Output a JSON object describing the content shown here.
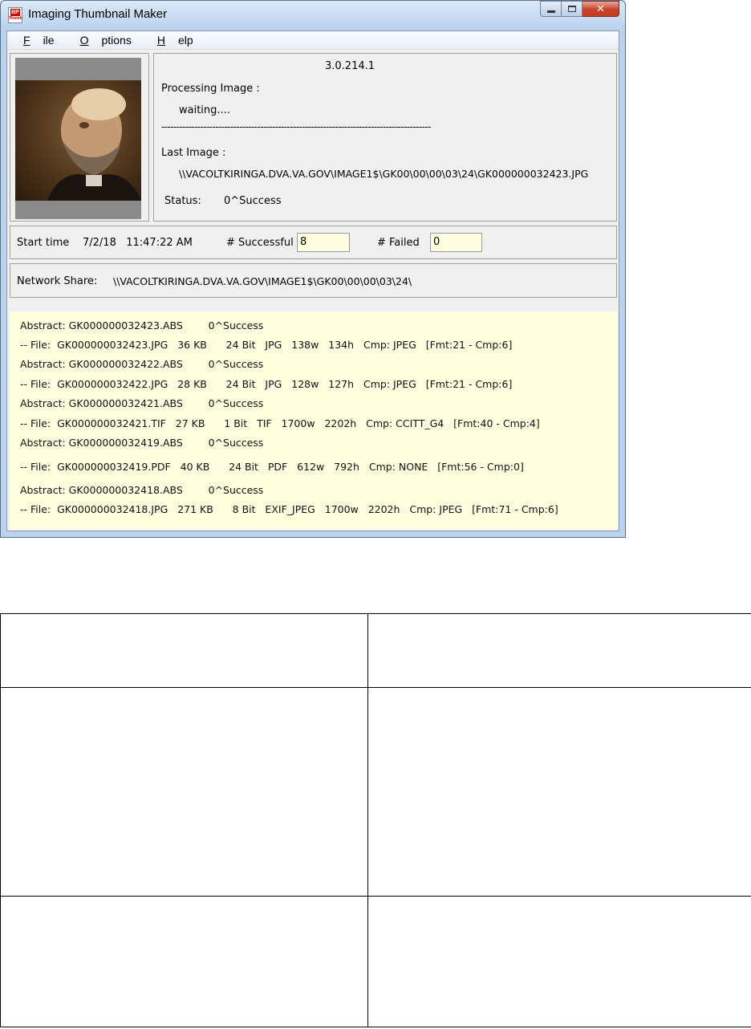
{
  "window": {
    "title": "Imaging Thumbnail Maker",
    "icon_text_top": "BP",
    "icon_text_bottom": "Thumb"
  },
  "menu": {
    "file": "File",
    "options": "Options",
    "help": "Help"
  },
  "info": {
    "version": "3.0.214.1",
    "processing_label": "Processing Image :",
    "processing_value": "waiting....",
    "separator": "------------------------------------------------------------------------------------------",
    "last_image_label": "Last Image :",
    "last_image_value": "\\\\VACOLTKIRINGA.DVA.VA.GOV\\IMAGE1$\\GK00\\00\\00\\03\\24\\GK000000032423.JPG",
    "status_label": "Status:",
    "status_value": "0^Success"
  },
  "stats": {
    "start_time_label": "Start time",
    "start_time_value": "7/2/18   11:47:22 AM",
    "successful_label": "# Successful",
    "successful_value": "8",
    "failed_label": "# Failed",
    "failed_value": "0"
  },
  "network": {
    "label": "Network Share:",
    "value": "\\\\VACOLTKIRINGA.DVA.VA.GOV\\IMAGE1$\\GK00\\00\\00\\03\\24\\"
  },
  "log": [
    "Abstract: GK000000032423.ABS        0^Success",
    "-- File:  GK000000032423.JPG   36 KB      24 Bit   JPG   138w   134h   Cmp: JPEG   [Fmt:21 - Cmp:6]",
    "Abstract: GK000000032422.ABS        0^Success",
    "-- File:  GK000000032422.JPG   28 KB      24 Bit   JPG   128w   127h   Cmp: JPEG   [Fmt:21 - Cmp:6]",
    "Abstract: GK000000032421.ABS        0^Success",
    "-- File:  GK000000032421.TIF   27 KB      1 Bit   TIF   1700w   2202h   Cmp: CCITT_G4   [Fmt:40 - Cmp:4]",
    "Abstract: GK000000032419.ABS        0^Success",
    "-- File:  GK000000032419.PDF   40 KB      24 Bit   PDF   612w   792h   Cmp: NONE   [Fmt:56 - Cmp:0]",
    "Abstract: GK000000032418.ABS        0^Success",
    "-- File:  GK000000032418.JPG   271 KB      8 Bit   EXIF_JPEG   1700w   2202h   Cmp: JPEG   [Fmt:71 - Cmp:6]"
  ]
}
